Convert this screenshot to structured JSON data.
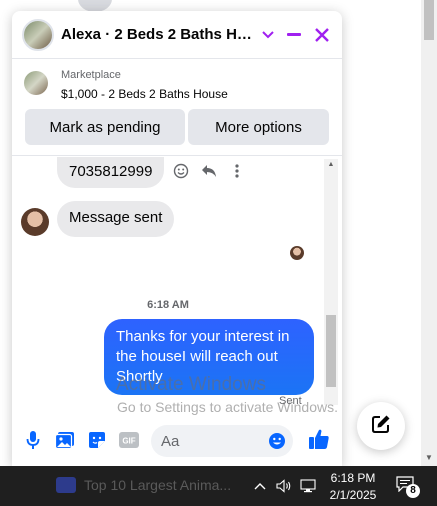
{
  "chat": {
    "title": "Alexa · 2 Beds 2 Baths Hou...",
    "listing": {
      "source": "Marketplace",
      "title": "$1,000 - 2 Beds 2 Baths House"
    },
    "actions": {
      "mark_pending": "Mark as pending",
      "more_options": "More options"
    },
    "messages": {
      "phone_bubble": "7035812999",
      "message_sent": "Message sent",
      "timestamp": "6:18 AM",
      "outgoing": "Thanks for your interest in the houseI will reach out Shortly",
      "status": "Sent"
    },
    "composer": {
      "placeholder": "Aa"
    }
  },
  "watermark": {
    "line1": "Activate Windows",
    "line2": "Go to Settings to activate Windows."
  },
  "taskbar": {
    "app_label": "Top 10 Largest Anima...",
    "time": "6:18 PM",
    "date": "2/1/2025",
    "notification_count": "8"
  },
  "colors": {
    "accent": "#a020f0",
    "messenger_blue": "#0866ff",
    "outgoing_bubble": "#2e62ff"
  }
}
